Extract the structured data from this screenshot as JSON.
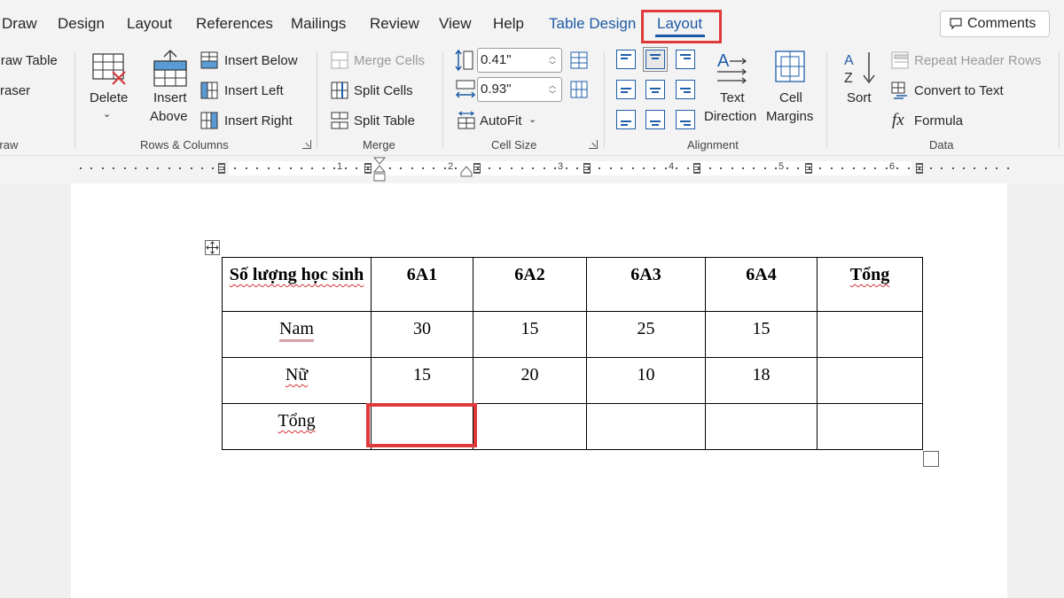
{
  "tabs": {
    "draw": "Draw",
    "design": "Design",
    "layout": "Layout",
    "references": "References",
    "mailings": "Mailings",
    "review": "Review",
    "view": "View",
    "help": "Help",
    "table_design": "Table Design",
    "table_layout": "Layout"
  },
  "comments_label": "Comments",
  "ribbon": {
    "draw": {
      "draw_table": "Draw Table",
      "eraser": "Eraser",
      "group": "Draw"
    },
    "rows_columns": {
      "delete": "Delete",
      "insert_above_1": "Insert",
      "insert_above_2": "Above",
      "insert_below": "Insert Below",
      "insert_left": "Insert Left",
      "insert_right": "Insert Right",
      "group": "Rows & Columns"
    },
    "merge": {
      "merge_cells": "Merge Cells",
      "split_cells": "Split Cells",
      "split_table": "Split Table",
      "group": "Merge"
    },
    "cell_size": {
      "height": "0.41\"",
      "width": "0.93\"",
      "autofit": "AutoFit",
      "group": "Cell Size"
    },
    "alignment": {
      "text_direction_1": "Text",
      "text_direction_2": "Direction",
      "cell_margins_1": "Cell",
      "cell_margins_2": "Margins",
      "group": "Alignment"
    },
    "data": {
      "sort": "Sort",
      "repeat_header": "Repeat Header Rows",
      "convert_to_text": "Convert to Text",
      "formula": "Formula",
      "group": "Data"
    }
  },
  "ruler": {
    "numbers": [
      "1",
      "2",
      "3",
      "4",
      "5",
      "6"
    ]
  },
  "table": {
    "header": [
      "Số lượng học sinh",
      "6A1",
      "6A2",
      "6A3",
      "6A4",
      "Tổng"
    ],
    "rows": [
      {
        "label": "Nam",
        "values": [
          "30",
          "15",
          "25",
          "15",
          ""
        ]
      },
      {
        "label": "Nữ",
        "values": [
          "15",
          "20",
          "10",
          "18",
          ""
        ]
      },
      {
        "label": "Tổng",
        "values": [
          "",
          "",
          "",
          "",
          ""
        ]
      }
    ]
  },
  "colors": {
    "highlight": "#e0393a",
    "context_tab": "#1d5aa6",
    "icon_blue": "#1f5ea8"
  }
}
